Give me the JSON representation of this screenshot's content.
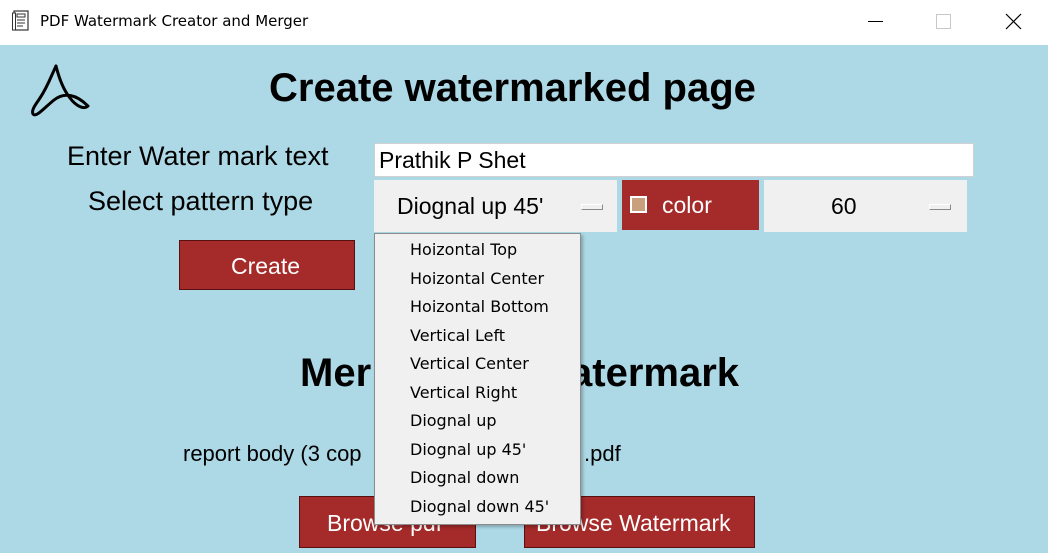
{
  "window": {
    "title": "PDF Watermark Creator and Merger",
    "minimize_glyph": "—",
    "maximize_glyph": "☐",
    "close_glyph": "✕"
  },
  "create_section": {
    "heading": "Create watermarked page",
    "watermark_label": "Enter Water mark text",
    "watermark_value": "Prathik P Shet",
    "pattern_label": "Select pattern type",
    "pattern_selected": "Diognal up 45'",
    "color_button": "color",
    "color_swatch": "#c8a07e",
    "size_selected": "60",
    "create_button": "Create"
  },
  "merge_section": {
    "heading_left": "Mer",
    "heading_right": "atermark",
    "file_left": "report body (3 cop",
    "file_right": ".pdf",
    "browse_pdf_button": "Browse pdf",
    "browse_watermark_button": "Browse Watermark"
  },
  "pattern_dropdown": {
    "items": [
      "Hoizontal Top",
      "Hoizontal Center",
      "Hoizontal Bottom",
      "Vertical Left",
      "Vertical Center",
      "Vertical Right",
      "Diognal up",
      "Diognal up 45'",
      "Diognal down",
      "Diognal down 45'"
    ]
  },
  "colors": {
    "background": "#add8e6",
    "button": "#a52a2a",
    "button_text": "#ffffff"
  },
  "icons": {
    "app": "pdf-document-icon",
    "logo": "acrobat-logo-icon"
  }
}
